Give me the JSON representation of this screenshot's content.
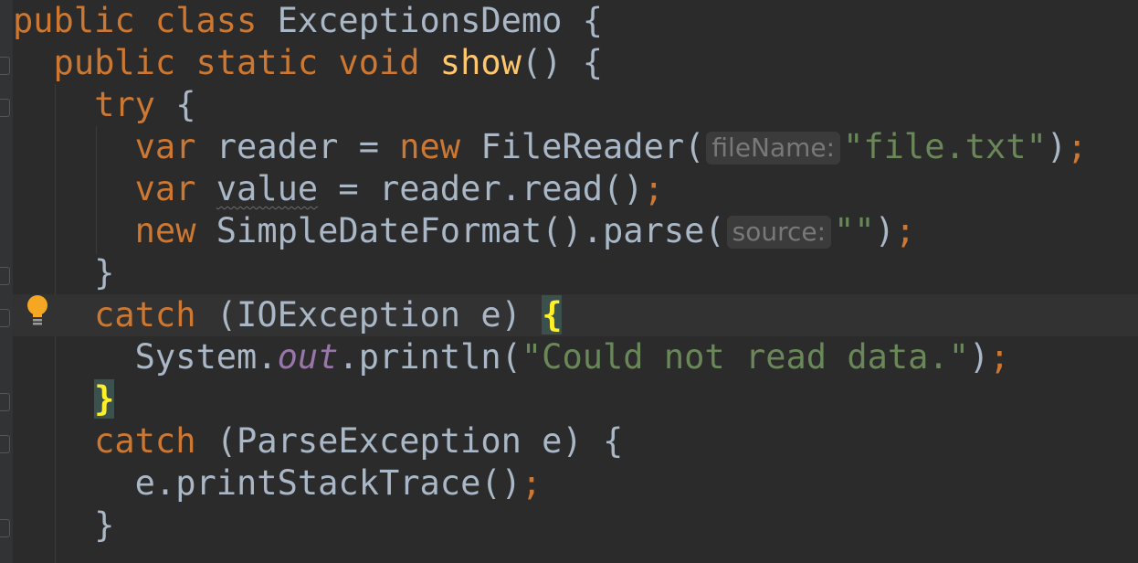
{
  "editor": {
    "lines": [
      [
        {
          "t": "public class ",
          "c": "kw"
        },
        {
          "t": "ExceptionsDemo {",
          "c": "plain"
        }
      ],
      [
        {
          "t": "  public static void ",
          "c": "kw"
        },
        {
          "t": "show",
          "c": "fn"
        },
        {
          "t": "() {",
          "c": "plain"
        }
      ],
      [
        {
          "t": "    try ",
          "c": "kw"
        },
        {
          "t": "{",
          "c": "plain"
        }
      ],
      [
        {
          "t": "      var ",
          "c": "kw"
        },
        {
          "t": "reader = ",
          "c": "plain"
        },
        {
          "t": "new ",
          "c": "kw"
        },
        {
          "t": "FileReader(",
          "c": "plain"
        },
        {
          "t": "fileName:",
          "c": "hint"
        },
        {
          "t": "\"file.txt\"",
          "c": "str"
        },
        {
          "t": ")",
          "c": "plain"
        },
        {
          "t": ";",
          "c": "punc"
        }
      ],
      [
        {
          "t": "      var ",
          "c": "kw"
        },
        {
          "t": "value",
          "c": "unused"
        },
        {
          "t": " = reader.read()",
          "c": "plain"
        },
        {
          "t": ";",
          "c": "punc"
        }
      ],
      [
        {
          "t": "      new ",
          "c": "kw"
        },
        {
          "t": "SimpleDateFormat().parse(",
          "c": "plain"
        },
        {
          "t": "source:",
          "c": "hint"
        },
        {
          "t": "\"\"",
          "c": "str"
        },
        {
          "t": ")",
          "c": "plain"
        },
        {
          "t": ";",
          "c": "punc"
        }
      ],
      [
        {
          "t": "    }",
          "c": "plain"
        }
      ],
      [
        {
          "t": "    catch ",
          "c": "kw"
        },
        {
          "t": "(IOException e) ",
          "c": "plain"
        },
        {
          "t": "{",
          "c": "brace-match"
        }
      ],
      [
        {
          "t": "      System.",
          "c": "plain"
        },
        {
          "t": "out",
          "c": "field"
        },
        {
          "t": ".println(",
          "c": "plain"
        },
        {
          "t": "\"Could not read data.\"",
          "c": "str"
        },
        {
          "t": ")",
          "c": "plain"
        },
        {
          "t": ";",
          "c": "punc"
        }
      ],
      [
        {
          "t": "    ",
          "c": "plain"
        },
        {
          "t": "}",
          "c": "brace-match"
        }
      ],
      [
        {
          "t": "    catch ",
          "c": "kw"
        },
        {
          "t": "(ParseException e) {",
          "c": "plain"
        }
      ],
      [
        {
          "t": "      e.printStackTrace()",
          "c": "plain"
        },
        {
          "t": ";",
          "c": "punc"
        }
      ],
      [
        {
          "t": "    }",
          "c": "plain"
        }
      ]
    ],
    "current_line": 7,
    "intention_icon": "lightbulb-icon",
    "colors": {
      "background": "#2b2b2b",
      "keyword": "#cc7832",
      "method": "#ffc66d",
      "string": "#6a8759",
      "field": "#9876aa",
      "text": "#a9b7c6",
      "hint": "#787878",
      "brace_match": "#ffef28"
    }
  }
}
